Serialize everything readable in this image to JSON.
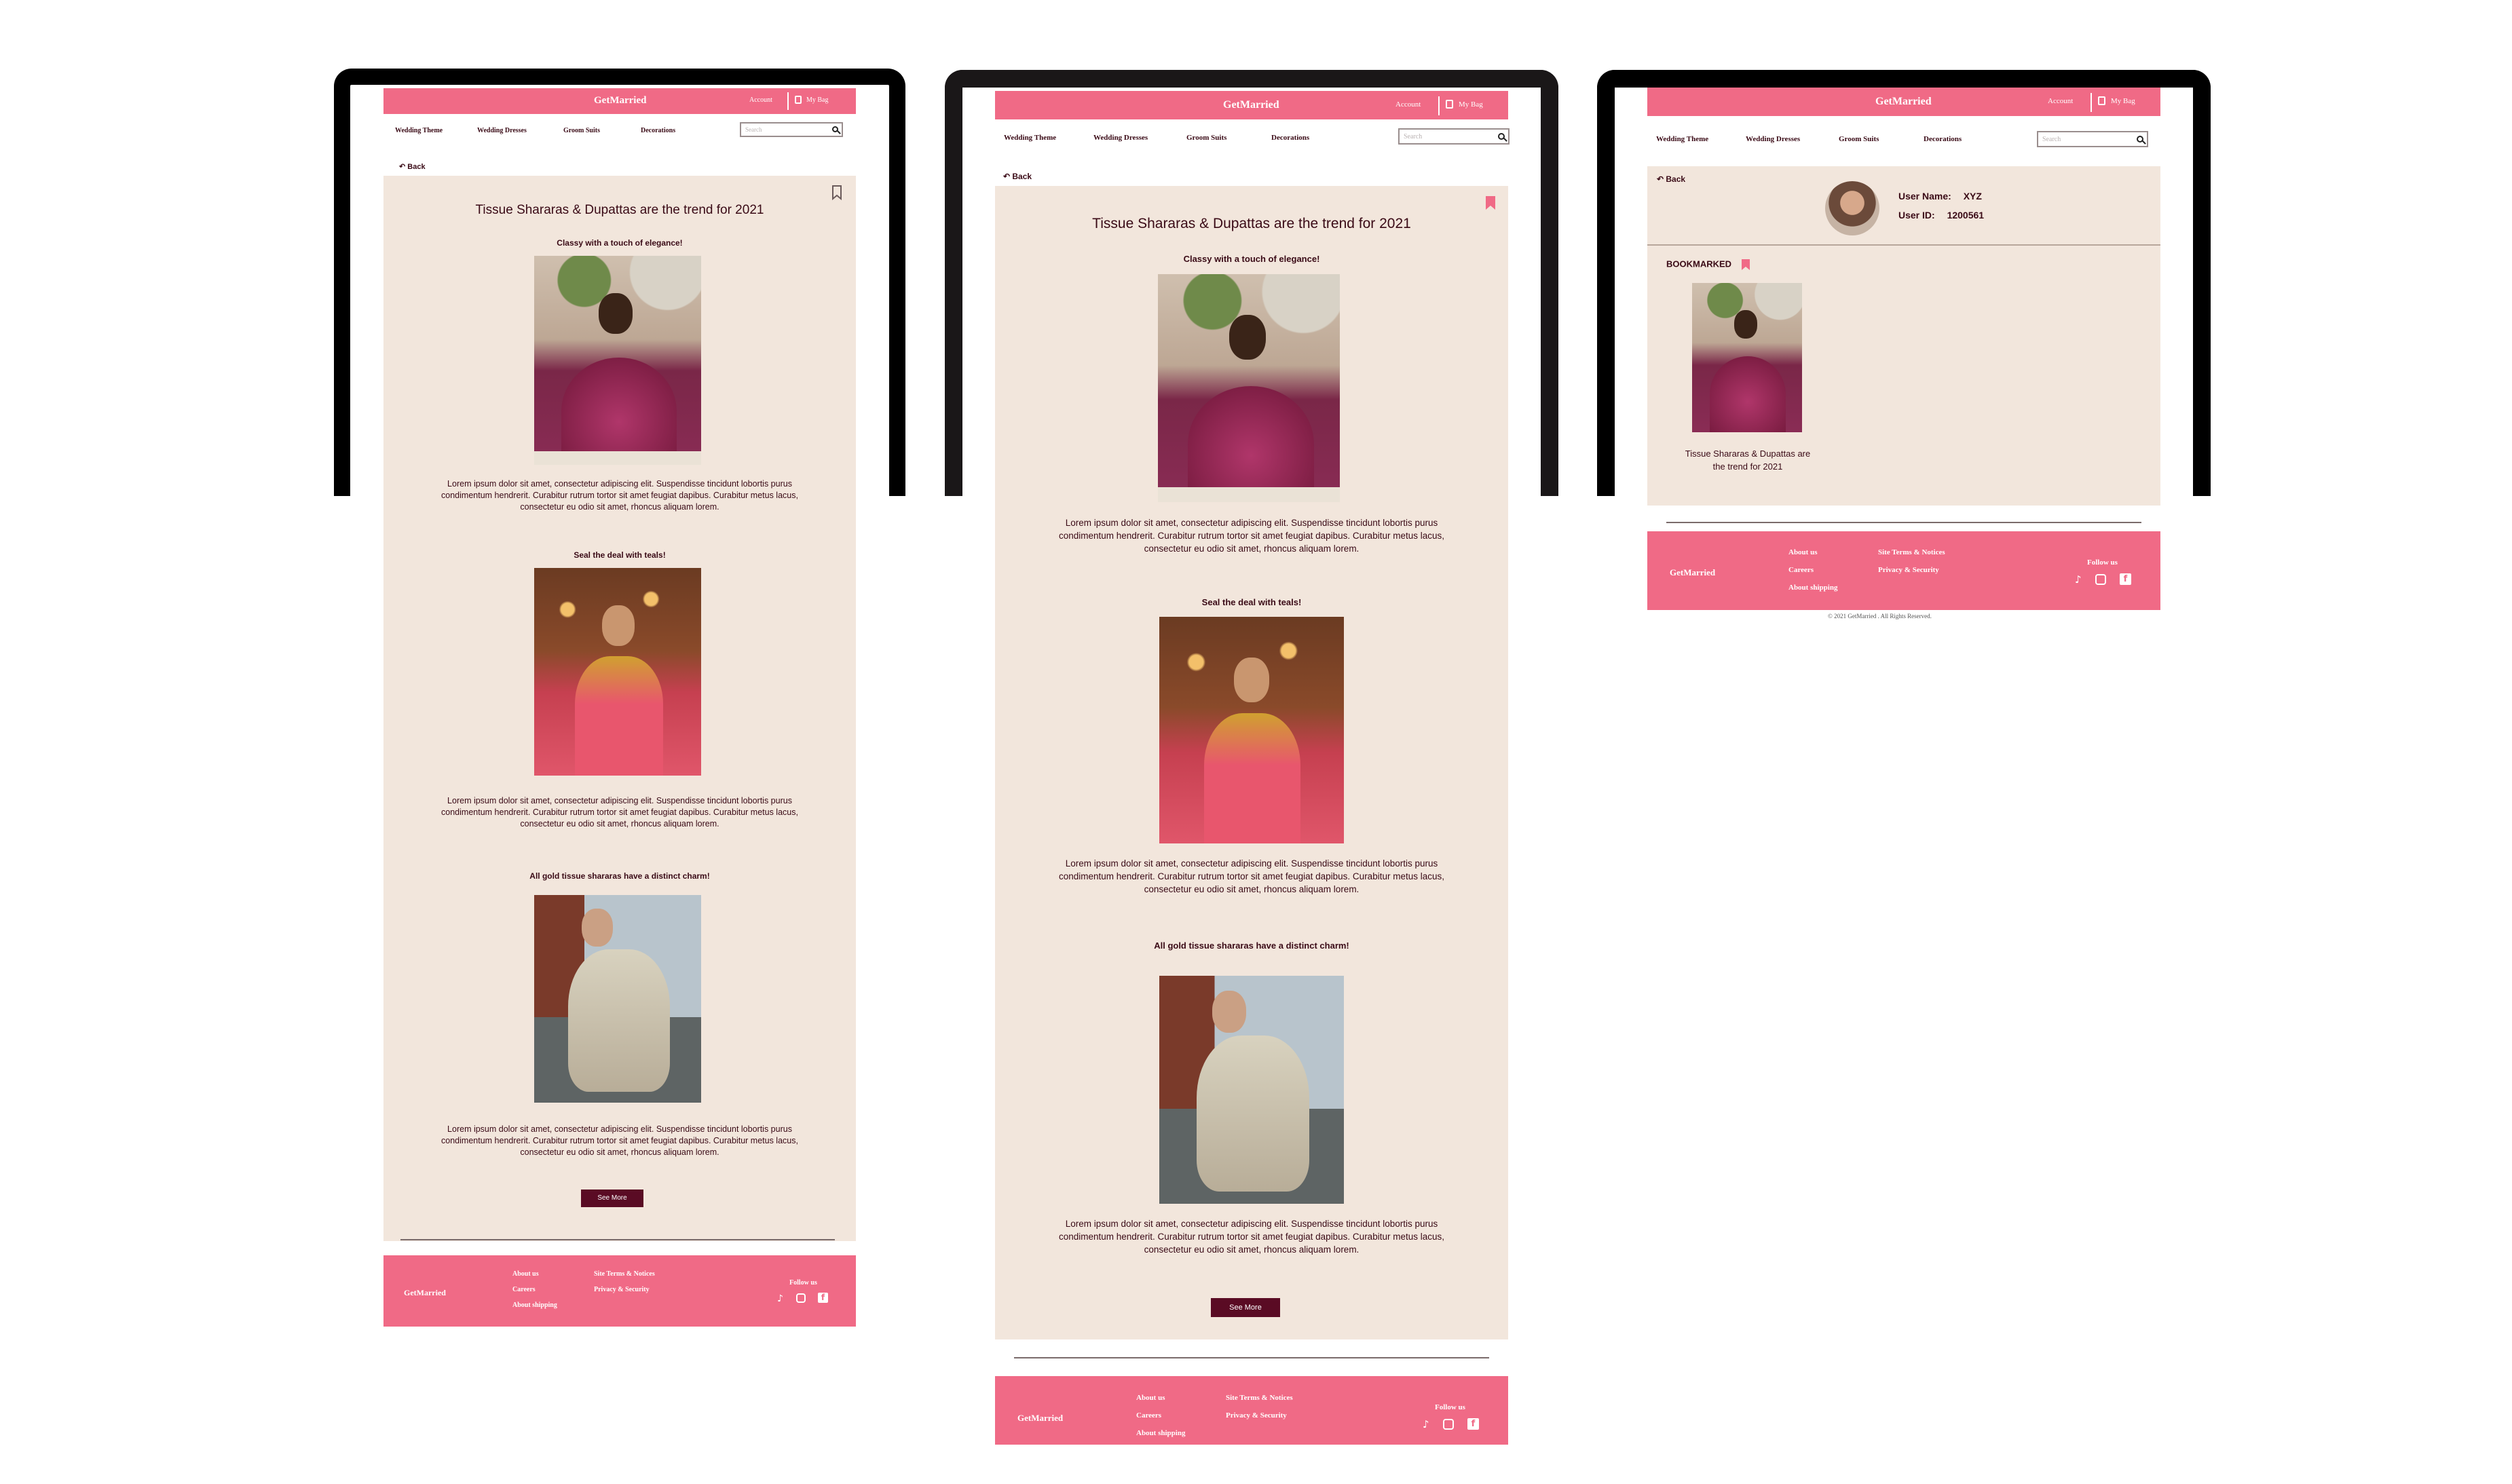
{
  "brand": "GetMarried",
  "header": {
    "account": "Account",
    "bag": "My Bag"
  },
  "nav": [
    "Wedding Theme",
    "Wedding Dresses",
    "Groom Suits",
    "Decorations"
  ],
  "search_placeholder": "Search",
  "back_label": "Back",
  "article": {
    "title": "Tissue Shararas & Dupattas are the trend for 2021",
    "sections": [
      {
        "heading": "Classy with a touch of elegance!",
        "text": "Lorem ipsum dolor sit amet, consectetur adipiscing elit. Suspendisse tincidunt lobortis purus condimentum hendrerit. Curabitur rutrum tortor sit amet feugiat dapibus. Curabitur metus lacus, consectetur eu odio sit amet, rhoncus aliquam lorem."
      },
      {
        "heading": "Seal the deal with teals!",
        "text": "Lorem ipsum dolor sit amet, consectetur adipiscing elit. Suspendisse tincidunt lobortis purus condimentum hendrerit. Curabitur rutrum tortor sit amet feugiat dapibus. Curabitur metus lacus, consectetur eu odio sit amet, rhoncus aliquam lorem."
      },
      {
        "heading": "All gold tissue shararas have a distinct charm!",
        "text": "Lorem ipsum dolor sit amet, consectetur adipiscing elit. Suspendisse tincidunt lobortis purus condimentum hendrerit. Curabitur rutrum tortor sit amet feugiat dapibus. Curabitur metus lacus, consectetur eu odio sit amet, rhoncus aliquam lorem."
      }
    ],
    "see_more": "See More"
  },
  "profile": {
    "user_name_label": "User Name:",
    "user_name": "XYZ",
    "user_id_label": "User ID:",
    "user_id": "1200561",
    "bookmarked_label": "BOOKMARKED",
    "bookmarked_item_title": "Tissue Shararas & Dupattas are the trend for 2021"
  },
  "footer": {
    "links_col1": [
      "About us",
      "Careers",
      "About shipping"
    ],
    "links_col2": [
      "Site Terms & Notices",
      "Privacy & Security"
    ],
    "follow": "Follow us",
    "copyright": "2021 GetMarried . All Rights Reserved."
  },
  "colors": {
    "accent": "#f06a86",
    "cream": "#f2e6dc",
    "maroon": "#5a0b24",
    "text": "#3a0a16"
  },
  "icons": [
    "shopping-bag-icon",
    "search-icon",
    "back-arrow-icon",
    "bookmark-icon",
    "tiktok-icon",
    "instagram-icon",
    "facebook-icon",
    "copyright-icon"
  ]
}
